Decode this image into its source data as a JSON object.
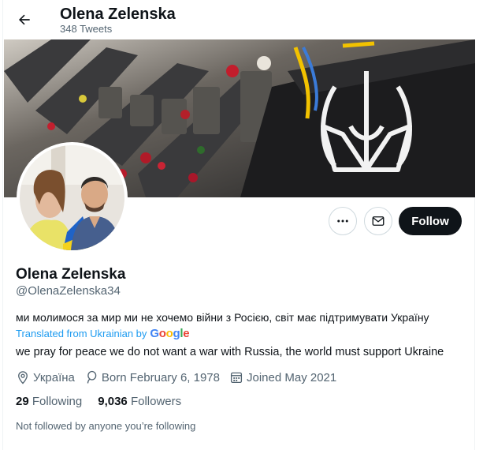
{
  "header": {
    "name": "Olena Zelenska",
    "tweet_count": "348 Tweets"
  },
  "profile": {
    "name": "Olena Zelenska",
    "handle": "@OlenaZelenska34",
    "bio": "ми молимося за мир ми не хочемо війни з Росією, світ має підтримувати Україну",
    "translated_label": "Translated from Ukrainian by",
    "translation": "we pray for peace we do not want a war with Russia, the world must support Ukraine",
    "location": "Україна",
    "birthday": "Born February 6, 1978",
    "joined": "Joined May 2021",
    "following_count": "29",
    "following_label": "Following",
    "followers_count": "9,036",
    "followers_label": "Followers",
    "followed_note": "Not followed by anyone you’re following"
  },
  "actions": {
    "follow_label": "Follow",
    "more_icon": "more-icon",
    "message_icon": "envelope-icon"
  },
  "colors": {
    "accent": "#1d9bf0",
    "text_primary": "#0f1419",
    "text_secondary": "#536471",
    "follow_button": "#0f1419"
  }
}
